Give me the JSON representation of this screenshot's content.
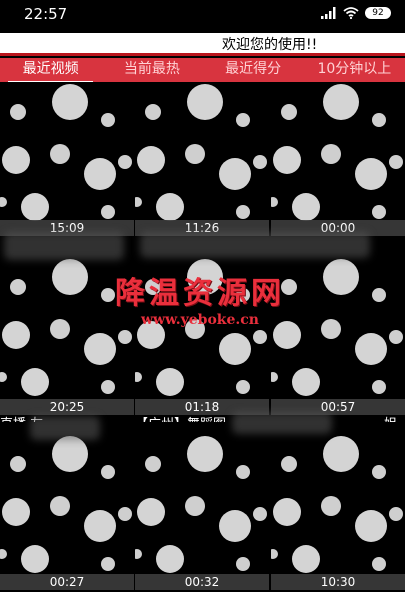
{
  "status_bar": {
    "time": "22:57",
    "battery": "92"
  },
  "marquee": {
    "text": "欢迎您的使用!!"
  },
  "tabs": [
    {
      "label": "最近视频",
      "active": true
    },
    {
      "label": "当前最热",
      "active": false
    },
    {
      "label": "最近得分",
      "active": false
    },
    {
      "label": "10分钟以上",
      "active": false
    }
  ],
  "videos": [
    {
      "duration": "15:09",
      "title": ""
    },
    {
      "duration": "11:26",
      "title": ""
    },
    {
      "duration": "00:00",
      "title": ""
    },
    {
      "duration": "20:25",
      "title": "直播 友..."
    },
    {
      "duration": "01:18",
      "title": "【广州】舞蹈图"
    },
    {
      "duration": "00:57",
      "title": "姐"
    },
    {
      "duration": "00:27",
      "title": ""
    },
    {
      "duration": "00:32",
      "title": ""
    },
    {
      "duration": "10:30",
      "title": ""
    }
  ],
  "watermark": {
    "main": "降温资源网",
    "sub": "www.yeboke.cn"
  },
  "colors": {
    "tab_bar": "#d8343f",
    "marquee_border": "#b8141c",
    "watermark": "#ea2f3c"
  }
}
